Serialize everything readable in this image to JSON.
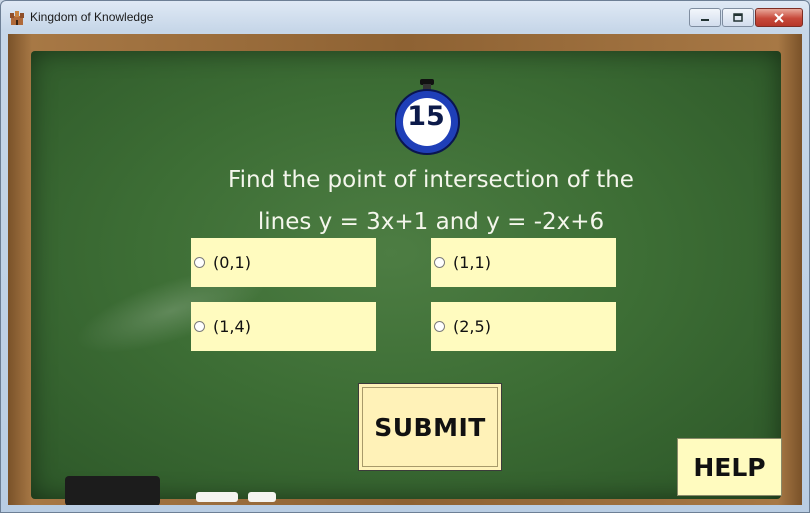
{
  "window": {
    "title": "Kingdom of Knowledge"
  },
  "timer": {
    "value": "15"
  },
  "question": {
    "line1": "Find the point of intersection of the",
    "line2": "lines y = 3x+1 and y = -2x+6"
  },
  "options": [
    "(0,1)",
    "(1,1)",
    "(1,4)",
    "(2,5)"
  ],
  "buttons": {
    "submit": "SUBMIT",
    "help": "HELP"
  },
  "icons": {
    "app": "castle-icon",
    "minimize": "minimize-icon",
    "maximize": "maximize-icon",
    "close": "close-icon",
    "timer": "stopwatch-icon"
  },
  "colors": {
    "board": "#3d6e35",
    "option_bg": "#fffbbf",
    "submit_bg": "#fff2b8",
    "timer_ring": "#1f3fb8"
  }
}
